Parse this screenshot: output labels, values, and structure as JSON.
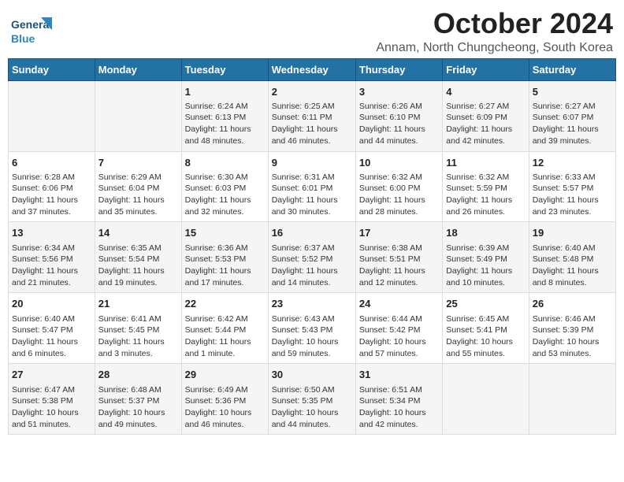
{
  "header": {
    "logo_line1": "General",
    "logo_line2": "Blue",
    "month": "October 2024",
    "subtitle": "Annam, North Chungcheong, South Korea"
  },
  "days_of_week": [
    "Sunday",
    "Monday",
    "Tuesday",
    "Wednesday",
    "Thursday",
    "Friday",
    "Saturday"
  ],
  "weeks": [
    [
      {
        "num": "",
        "info": ""
      },
      {
        "num": "",
        "info": ""
      },
      {
        "num": "1",
        "info": "Sunrise: 6:24 AM\nSunset: 6:13 PM\nDaylight: 11 hours and 48 minutes."
      },
      {
        "num": "2",
        "info": "Sunrise: 6:25 AM\nSunset: 6:11 PM\nDaylight: 11 hours and 46 minutes."
      },
      {
        "num": "3",
        "info": "Sunrise: 6:26 AM\nSunset: 6:10 PM\nDaylight: 11 hours and 44 minutes."
      },
      {
        "num": "4",
        "info": "Sunrise: 6:27 AM\nSunset: 6:09 PM\nDaylight: 11 hours and 42 minutes."
      },
      {
        "num": "5",
        "info": "Sunrise: 6:27 AM\nSunset: 6:07 PM\nDaylight: 11 hours and 39 minutes."
      }
    ],
    [
      {
        "num": "6",
        "info": "Sunrise: 6:28 AM\nSunset: 6:06 PM\nDaylight: 11 hours and 37 minutes."
      },
      {
        "num": "7",
        "info": "Sunrise: 6:29 AM\nSunset: 6:04 PM\nDaylight: 11 hours and 35 minutes."
      },
      {
        "num": "8",
        "info": "Sunrise: 6:30 AM\nSunset: 6:03 PM\nDaylight: 11 hours and 32 minutes."
      },
      {
        "num": "9",
        "info": "Sunrise: 6:31 AM\nSunset: 6:01 PM\nDaylight: 11 hours and 30 minutes."
      },
      {
        "num": "10",
        "info": "Sunrise: 6:32 AM\nSunset: 6:00 PM\nDaylight: 11 hours and 28 minutes."
      },
      {
        "num": "11",
        "info": "Sunrise: 6:32 AM\nSunset: 5:59 PM\nDaylight: 11 hours and 26 minutes."
      },
      {
        "num": "12",
        "info": "Sunrise: 6:33 AM\nSunset: 5:57 PM\nDaylight: 11 hours and 23 minutes."
      }
    ],
    [
      {
        "num": "13",
        "info": "Sunrise: 6:34 AM\nSunset: 5:56 PM\nDaylight: 11 hours and 21 minutes."
      },
      {
        "num": "14",
        "info": "Sunrise: 6:35 AM\nSunset: 5:54 PM\nDaylight: 11 hours and 19 minutes."
      },
      {
        "num": "15",
        "info": "Sunrise: 6:36 AM\nSunset: 5:53 PM\nDaylight: 11 hours and 17 minutes."
      },
      {
        "num": "16",
        "info": "Sunrise: 6:37 AM\nSunset: 5:52 PM\nDaylight: 11 hours and 14 minutes."
      },
      {
        "num": "17",
        "info": "Sunrise: 6:38 AM\nSunset: 5:51 PM\nDaylight: 11 hours and 12 minutes."
      },
      {
        "num": "18",
        "info": "Sunrise: 6:39 AM\nSunset: 5:49 PM\nDaylight: 11 hours and 10 minutes."
      },
      {
        "num": "19",
        "info": "Sunrise: 6:40 AM\nSunset: 5:48 PM\nDaylight: 11 hours and 8 minutes."
      }
    ],
    [
      {
        "num": "20",
        "info": "Sunrise: 6:40 AM\nSunset: 5:47 PM\nDaylight: 11 hours and 6 minutes."
      },
      {
        "num": "21",
        "info": "Sunrise: 6:41 AM\nSunset: 5:45 PM\nDaylight: 11 hours and 3 minutes."
      },
      {
        "num": "22",
        "info": "Sunrise: 6:42 AM\nSunset: 5:44 PM\nDaylight: 11 hours and 1 minute."
      },
      {
        "num": "23",
        "info": "Sunrise: 6:43 AM\nSunset: 5:43 PM\nDaylight: 10 hours and 59 minutes."
      },
      {
        "num": "24",
        "info": "Sunrise: 6:44 AM\nSunset: 5:42 PM\nDaylight: 10 hours and 57 minutes."
      },
      {
        "num": "25",
        "info": "Sunrise: 6:45 AM\nSunset: 5:41 PM\nDaylight: 10 hours and 55 minutes."
      },
      {
        "num": "26",
        "info": "Sunrise: 6:46 AM\nSunset: 5:39 PM\nDaylight: 10 hours and 53 minutes."
      }
    ],
    [
      {
        "num": "27",
        "info": "Sunrise: 6:47 AM\nSunset: 5:38 PM\nDaylight: 10 hours and 51 minutes."
      },
      {
        "num": "28",
        "info": "Sunrise: 6:48 AM\nSunset: 5:37 PM\nDaylight: 10 hours and 49 minutes."
      },
      {
        "num": "29",
        "info": "Sunrise: 6:49 AM\nSunset: 5:36 PM\nDaylight: 10 hours and 46 minutes."
      },
      {
        "num": "30",
        "info": "Sunrise: 6:50 AM\nSunset: 5:35 PM\nDaylight: 10 hours and 44 minutes."
      },
      {
        "num": "31",
        "info": "Sunrise: 6:51 AM\nSunset: 5:34 PM\nDaylight: 10 hours and 42 minutes."
      },
      {
        "num": "",
        "info": ""
      },
      {
        "num": "",
        "info": ""
      }
    ]
  ]
}
